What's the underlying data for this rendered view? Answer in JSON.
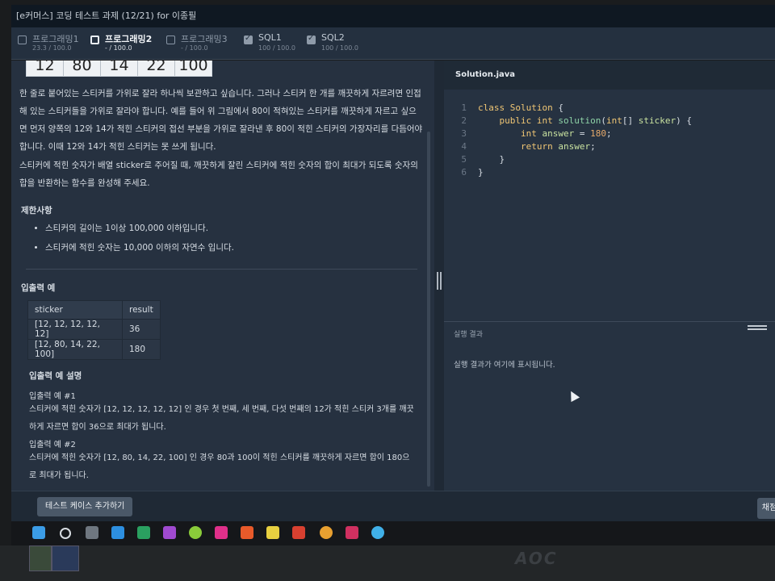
{
  "window": {
    "title": "[e커머스] 코딩 테스트 과제 (12/21) for 이종필"
  },
  "tabs": [
    {
      "name": "프로그래밍1",
      "score": "23.3 / 100.0",
      "checked": false,
      "active": false
    },
    {
      "name": "프로그래밍2",
      "score": "- / 100.0",
      "checked": false,
      "active": true
    },
    {
      "name": "프로그래밍3",
      "score": "- / 100.0",
      "checked": false,
      "active": false
    },
    {
      "name": "SQL1",
      "score": "100 / 100.0",
      "checked": true,
      "active": false
    },
    {
      "name": "SQL2",
      "score": "100 / 100.0",
      "checked": true,
      "active": false
    }
  ],
  "problem": {
    "sticker_strip": [
      "12",
      "80",
      "14",
      "22",
      "100"
    ],
    "para1": "한 줄로 붙어있는 스티커를 가위로 잘라 하나씩 보관하고 싶습니다. 그러나 스티커 한 개를 깨끗하게 자르려면 인접해 있는 스티커들을 가위로 잘라야 합니다. 예를 들어 위 그림에서 80이 적혀있는 스티커를 깨끗하게 자르고 싶으면 먼저 양쪽의 12와 14가 적힌 스티커의 접선 부분을 가위로 잘라낸 후 80이 적힌 스티커의 가장자리를 다듬어야 합니다. 이때 12와 14가 적힌 스티커는 못 쓰게 됩니다.",
    "para2": "스티커에 적힌 숫자가 배열 sticker로 주어질 때, 깨끗하게 잘린 스티커에 적힌 숫자의 합이 최대가 되도록 숫자의 합을 반환하는 함수를 완성해 주세요.",
    "constraints_heading": "제한사항",
    "constraints": [
      "스티커의 길이는 1이상 100,000 이하입니다.",
      "스티커에 적힌 숫자는 10,000 이하의 자연수 입니다."
    ],
    "io_heading": "입출력 예",
    "io_table": {
      "headers": [
        "sticker",
        "result"
      ],
      "rows": [
        [
          "[12, 12, 12, 12, 12]",
          "36"
        ],
        [
          "[12, 80, 14, 22, 100]",
          "180"
        ]
      ]
    },
    "explain_heading": "입출력 예 설명",
    "ex1_title": "입출력 예 #1",
    "ex1_text": "스티커에 적힌 숫자가 [12, 12, 12, 12, 12] 인 경우 첫 번째, 세 번째, 다섯 번째의 12가 적힌 스티커 3개를 깨끗하게 자르면 합이 36으로 최대가 됩니다.",
    "ex2_title": "입출력 예 #2",
    "ex2_text": "스티커에 적힌 숫자가 [12, 80, 14, 22, 100] 인 경우 80과 100이 적힌 스티커를 깨끗하게 자르면 합이 180으로 최대가 됩니다."
  },
  "editor": {
    "filename": "Solution.java",
    "line_numbers": [
      "1",
      "2",
      "3",
      "4",
      "5",
      "6"
    ]
  },
  "result": {
    "label": "실행 결과",
    "placeholder": "실행 결과가 여기에 표시됩니다."
  },
  "bottom": {
    "add_testcase": "테스트 케이스 추가하기",
    "submit": "채점"
  },
  "monitor": {
    "brand": "AOC"
  }
}
